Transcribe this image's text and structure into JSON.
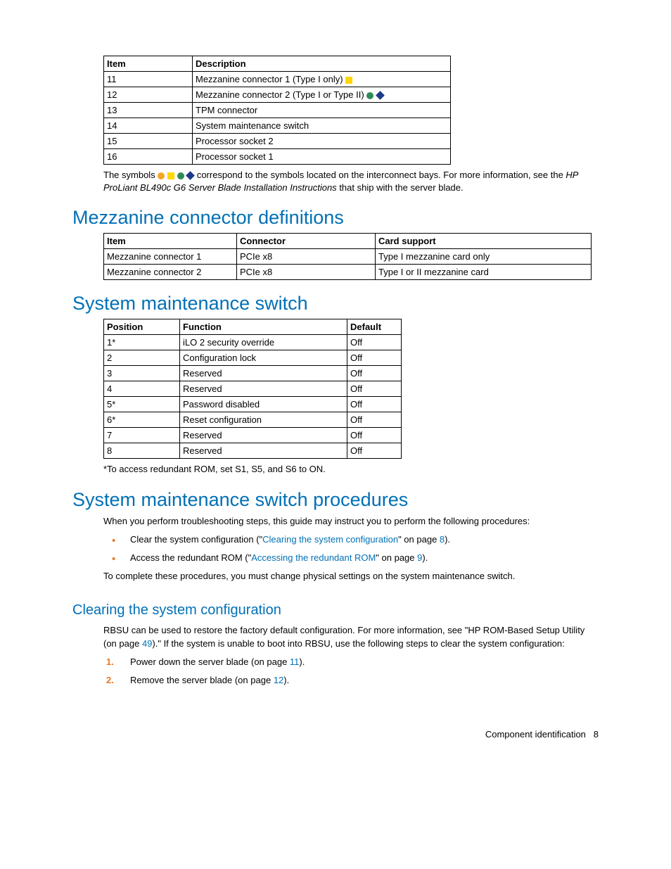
{
  "table_item_desc": {
    "headers": [
      "Item",
      "Description"
    ],
    "rows": [
      {
        "item": "11",
        "desc": "Mezzanine connector 1 (Type I only)",
        "symbols": [
          "yellow-square"
        ]
      },
      {
        "item": "12",
        "desc": "Mezzanine connector 2 (Type I or Type II)",
        "symbols": [
          "green-circle",
          "blue-diamond"
        ]
      },
      {
        "item": "13",
        "desc": "TPM connector",
        "symbols": []
      },
      {
        "item": "14",
        "desc": "System maintenance switch",
        "symbols": []
      },
      {
        "item": "15",
        "desc": "Processor socket 2",
        "symbols": []
      },
      {
        "item": "16",
        "desc": "Processor socket 1",
        "symbols": []
      }
    ],
    "widths": [
      126,
      367
    ]
  },
  "symbols_note": {
    "pre": "The symbols ",
    "post": " correspond to the symbols located on the interconnect bays. For more information, see the ",
    "doc": "HP ProLiant BL490c G6 Server Blade Installation Instructions",
    "tail": " that ship with the server blade."
  },
  "h_mezz": "Mezzanine connector definitions",
  "table_mezz": {
    "headers": [
      "Item",
      "Connector",
      "Card support"
    ],
    "rows": [
      [
        "Mezzanine connector 1",
        "PCIe x8",
        "Type I mezzanine card only"
      ],
      [
        "Mezzanine connector 2",
        "PCIe x8",
        "Type I or II mezzanine card"
      ]
    ],
    "widths": [
      189,
      197,
      307
    ]
  },
  "h_sms": "System maintenance switch",
  "table_sms": {
    "headers": [
      "Position",
      "Function",
      "Default"
    ],
    "rows": [
      [
        "1*",
        "iLO 2 security override",
        "Off"
      ],
      [
        "2",
        "Configuration lock",
        "Off"
      ],
      [
        "3",
        "Reserved",
        "Off"
      ],
      [
        "4",
        "Reserved",
        "Off"
      ],
      [
        "5*",
        "Password disabled",
        "Off"
      ],
      [
        "6*",
        "Reset configuration",
        "Off"
      ],
      [
        "7",
        "Reserved",
        "Off"
      ],
      [
        "8",
        "Reserved",
        "Off"
      ]
    ],
    "widths": [
      108,
      238,
      77
    ]
  },
  "sms_footnote": "*To access redundant ROM, set S1, S5, and S6 to ON.",
  "h_smsp": "System maintenance switch procedures",
  "smsp_intro": "When you perform troubleshooting steps, this guide may instruct you to perform the following procedures:",
  "smsp_bullets": [
    {
      "pre": "Clear the system configuration (\"",
      "link": "Clearing the system configuration",
      "mid": "\" on page ",
      "page": "8",
      "post": ")."
    },
    {
      "pre": "Access the redundant ROM (\"",
      "link": "Accessing the redundant ROM",
      "mid": "\" on page ",
      "page": "9",
      "post": ")."
    }
  ],
  "smsp_outro": "To complete these procedures, you must change physical settings on the system maintenance switch.",
  "h_csc": "Clearing the system configuration",
  "csc_para": {
    "pre": "RBSU can be used to restore the factory default configuration. For more information, see \"HP ROM-Based Setup Utility (on page ",
    "page": "49",
    "post": ").\" If the system is unable to boot into RBSU, use the following steps to clear the system configuration:"
  },
  "csc_steps": [
    {
      "pre": "Power down the server blade (on page ",
      "page": "11",
      "post": ")."
    },
    {
      "pre": "Remove the server blade (on page ",
      "page": "12",
      "post": ")."
    }
  ],
  "pagefoot": {
    "section": "Component identification",
    "num": "8"
  }
}
